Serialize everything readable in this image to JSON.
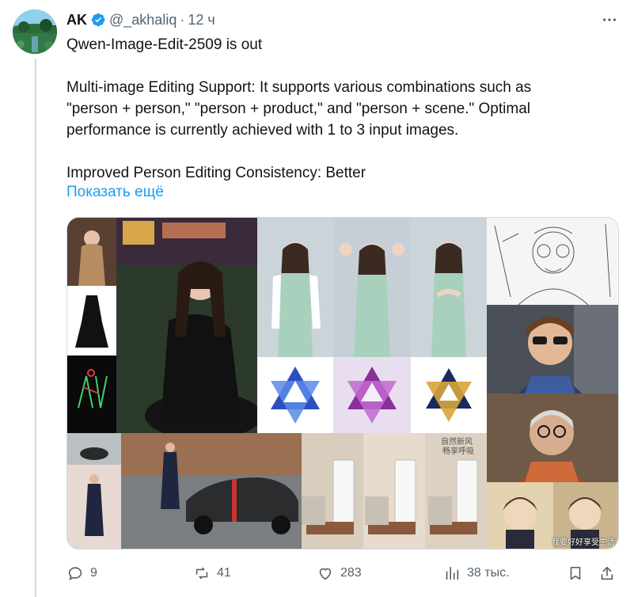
{
  "tweet": {
    "author_name": "AK",
    "handle": "@_akhaliq",
    "separator": "·",
    "time": "12 ч",
    "lines": [
      "Qwen-Image-Edit-2509 is out",
      "Multi-image Editing Support: It supports various combinations such as",
      "\"person + person,\" \"person + product,\" and \"person + scene.\" Optimal",
      "performance is currently achieved with 1 to 3 input images.",
      "Improved Person Editing Consistency: Better"
    ],
    "show_more": "Показать ещё"
  },
  "media": {
    "overlay_text_1": "自然新风",
    "overlay_text_2": "畅享呼吸",
    "overlay_text_3": "我要好好享受生活"
  },
  "actions": {
    "replies": "9",
    "reposts": "41",
    "likes": "283",
    "views": "38 тыс."
  },
  "colors": {
    "accent": "#1d9bf0",
    "secondary_text": "#536471",
    "verified": "#1d9bf0"
  },
  "icons": {
    "more": "ellipsis-icon",
    "reply": "comment-icon",
    "repost": "repost-icon",
    "like": "heart-icon",
    "views": "analytics-icon",
    "bookmark": "bookmark-icon",
    "share": "share-icon"
  }
}
